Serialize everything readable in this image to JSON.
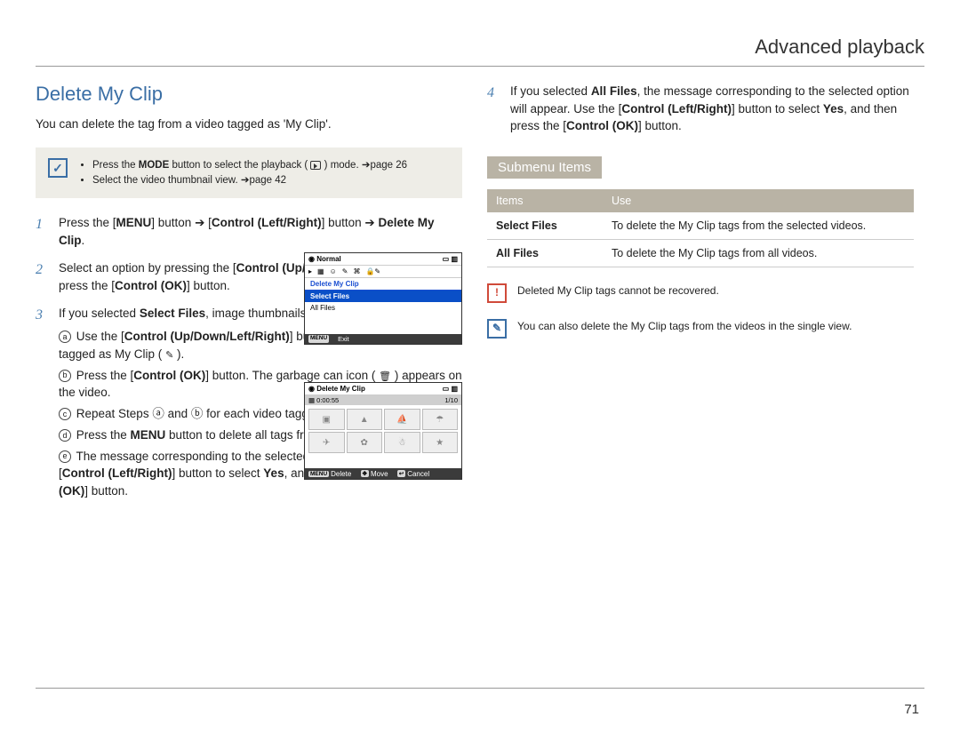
{
  "header": {
    "title": "Advanced playback"
  },
  "section": {
    "title": "Delete My Clip",
    "intro": "You can delete the tag from a video tagged as 'My Clip'."
  },
  "infobox": {
    "bullet1_a": "Press the ",
    "bullet1_mode": "MODE",
    "bullet1_b": " button to select the playback ( ",
    "bullet1_c": " ) mode. ➔page 26",
    "bullet2": "Select the video thumbnail view. ➔page 42"
  },
  "steps": {
    "s1": {
      "a": "Press the [",
      "menu": "MENU",
      "b": "] button ➔ [",
      "clr": "Control (Left/Right)",
      "c": "] button ➔ ",
      "dmc": "Delete My Clip",
      "d": "."
    },
    "s2": {
      "a": "Select an option by pressing the [",
      "cud": "Control (Up/Down)",
      "b": "] button, and then press the [",
      "cok": "Control (OK)",
      "c": "] button."
    },
    "s3": {
      "a": "If you selected ",
      "sf": "Select Files",
      "b": ", image thumbnails will appear.",
      "sub_a1": "Use the [",
      "sub_a_ctrl": "Control (Up/Down/Left/Right)",
      "sub_a2": "] button to move to the video tagged as My Clip ( ",
      "sub_a3": " ).",
      "sub_b1": "Press the [",
      "sub_b_cok": "Control (OK)",
      "sub_b2": "] button. The garbage can icon ( ",
      "sub_b3": " ) appears on the video.",
      "sub_c": "Repeat Steps ⓐ and ⓑ for each video tagged as My Clip ( ",
      "sub_c2": " ).",
      "sub_d1": "Press the ",
      "sub_d_menu": "MENU",
      "sub_d2": " button to delete all tags from the videos you selected.",
      "sub_e1": "The message corresponding to the selected option appears. Use the [",
      "sub_e_clr": "Control (Left/Right)",
      "sub_e2": "] button to select ",
      "sub_e_yes": "Yes",
      "sub_e3": ", and then press the [",
      "sub_e_cok": "Control (OK)",
      "sub_e4": "] button."
    },
    "s4": {
      "a": "If you selected ",
      "af": "All Files",
      "b": ", the message corresponding to the selected option will appear. Use the [",
      "clr": "Control (Left/Right)",
      "c": "] button to select ",
      "yes": "Yes",
      "d": ", and then press the [",
      "cok": "Control (OK)",
      "e": "] button."
    }
  },
  "screen_a": {
    "title": "Normal",
    "menu_title": "Delete My Clip",
    "opt_selected": "Select Files",
    "opt2": "All Files",
    "menu_btn": "MENU",
    "exit": "Exit"
  },
  "screen_b": {
    "title": "Delete My Clip",
    "time": "0:00:55",
    "count": "1/10",
    "menu_btn": "MENU",
    "f1": "Delete",
    "f2": "Move",
    "f3": "Cancel"
  },
  "submenu": {
    "heading": "Submenu Items",
    "th_items": "Items",
    "th_use": "Use",
    "rows": [
      {
        "name": "Select Files",
        "use": "To delete the My Clip tags from the selected videos."
      },
      {
        "name": "All Files",
        "use": "To delete the My Clip tags from all videos."
      }
    ]
  },
  "warn_note": "Deleted My Clip tags cannot be recovered.",
  "tip_note": "You can also delete the My Clip tags from the videos in the single view.",
  "page": "71"
}
